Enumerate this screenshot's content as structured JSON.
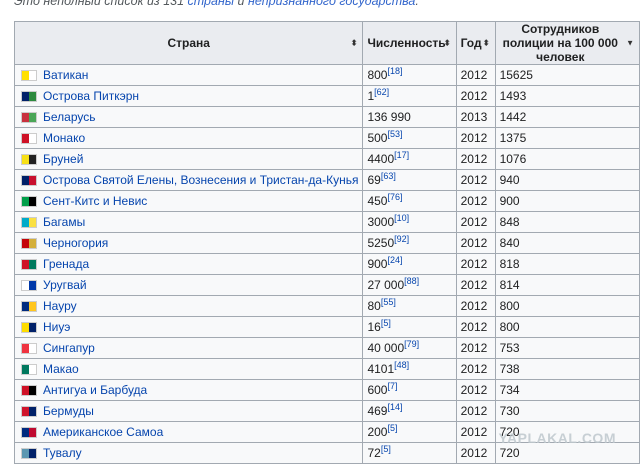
{
  "intro": {
    "prefix": "Это неполный список из 131 ",
    "link1": "страны",
    "middle": " и ",
    "link2": "непризнанного государства",
    "suffix": "."
  },
  "table": {
    "headers": [
      "Страна",
      "Численность",
      "Год",
      "Сотрудников полиции на 100 000 человек"
    ],
    "sort_icons": [
      "⬍",
      "⬍",
      "⬍",
      "▼"
    ],
    "rows": [
      {
        "country": "Ватикан",
        "count": "800",
        "ref": "[18]",
        "year": "2012",
        "per100k": "15625",
        "flag": [
          "#ffe000",
          "#ffffff"
        ]
      },
      {
        "country": "Острова Питкэрн",
        "count": "1",
        "ref": "[62]",
        "year": "2012",
        "per100k": "1493",
        "flag": [
          "#012169",
          "#2d8a3e"
        ]
      },
      {
        "country": "Беларусь",
        "count": "136 990",
        "ref": "",
        "year": "2013",
        "per100k": "1442",
        "flag": [
          "#c8313e",
          "#4aa657"
        ]
      },
      {
        "country": "Монако",
        "count": "500",
        "ref": "[53]",
        "year": "2012",
        "per100k": "1375",
        "flag": [
          "#ce1126",
          "#ffffff"
        ]
      },
      {
        "country": "Бруней",
        "count": "4400",
        "ref": "[17]",
        "year": "2012",
        "per100k": "1076",
        "flag": [
          "#f7e017",
          "#222222"
        ]
      },
      {
        "country": "Острова Святой Елены, Вознесения и Тристан-да-Кунья",
        "count": "69",
        "ref": "[63]",
        "year": "2012",
        "per100k": "940",
        "flag": [
          "#012169",
          "#c8102e"
        ]
      },
      {
        "country": "Сент-Китс и Невис",
        "count": "450",
        "ref": "[76]",
        "year": "2012",
        "per100k": "900",
        "flag": [
          "#009e49",
          "#000000"
        ]
      },
      {
        "country": "Багамы",
        "count": "3000",
        "ref": "[10]",
        "year": "2012",
        "per100k": "848",
        "flag": [
          "#00abc9",
          "#fae042"
        ]
      },
      {
        "country": "Черногория",
        "count": "5250",
        "ref": "[92]",
        "year": "2012",
        "per100k": "840",
        "flag": [
          "#c40308",
          "#d4af3a"
        ]
      },
      {
        "country": "Гренада",
        "count": "900",
        "ref": "[24]",
        "year": "2012",
        "per100k": "818",
        "flag": [
          "#ce1126",
          "#007a5e"
        ]
      },
      {
        "country": "Уругвай",
        "count": "27 000",
        "ref": "[88]",
        "year": "2012",
        "per100k": "814",
        "flag": [
          "#ffffff",
          "#0038a8"
        ]
      },
      {
        "country": "Науру",
        "count": "80",
        "ref": "[55]",
        "year": "2012",
        "per100k": "800",
        "flag": [
          "#002b7f",
          "#ffc61e"
        ]
      },
      {
        "country": "Ниуэ",
        "count": "16",
        "ref": "[5]",
        "year": "2012",
        "per100k": "800",
        "flag": [
          "#fedd00",
          "#012169"
        ]
      },
      {
        "country": "Сингапур",
        "count": "40 000",
        "ref": "[79]",
        "year": "2012",
        "per100k": "753",
        "flag": [
          "#ef3340",
          "#ffffff"
        ]
      },
      {
        "country": "Макао",
        "count": "4101",
        "ref": "[48]",
        "year": "2012",
        "per100k": "738",
        "flag": [
          "#00785e",
          "#ffffff"
        ]
      },
      {
        "country": "Антигуа и Барбуда",
        "count": "600",
        "ref": "[7]",
        "year": "2012",
        "per100k": "734",
        "flag": [
          "#ce1126",
          "#000000"
        ]
      },
      {
        "country": "Бермуды",
        "count": "469",
        "ref": "[14]",
        "year": "2012",
        "per100k": "730",
        "flag": [
          "#cf142b",
          "#012169"
        ]
      },
      {
        "country": "Американское Самоа",
        "count": "200",
        "ref": "[5]",
        "year": "2012",
        "per100k": "720",
        "flag": [
          "#002b7f",
          "#bf0a30"
        ]
      },
      {
        "country": "Тувалу",
        "count": "72",
        "ref": "[5]",
        "year": "2012",
        "per100k": "720",
        "flag": [
          "#5b97b1",
          "#012169"
        ]
      }
    ]
  },
  "watermark": "YAPLAKAL.COM"
}
